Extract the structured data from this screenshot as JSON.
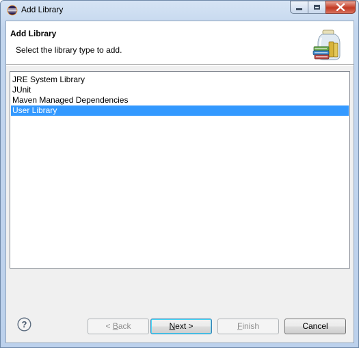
{
  "window": {
    "title": "Add Library",
    "icon": "eclipse-icon"
  },
  "header": {
    "title": "Add Library",
    "description": "Select the library type to add.",
    "image": "library-jar-books-icon"
  },
  "library_types": [
    {
      "label": "JRE System Library",
      "selected": false
    },
    {
      "label": "JUnit",
      "selected": false
    },
    {
      "label": "Maven Managed Dependencies",
      "selected": false
    },
    {
      "label": "User Library",
      "selected": true
    }
  ],
  "buttons": {
    "back": {
      "label": "< Back",
      "mnemonic": "B",
      "enabled": false
    },
    "next": {
      "label": "Next >",
      "mnemonic": "N",
      "enabled": true,
      "default": true
    },
    "finish": {
      "label": "Finish",
      "mnemonic": "F",
      "enabled": false
    },
    "cancel": {
      "label": "Cancel",
      "enabled": true
    }
  },
  "help": {
    "icon": "help-icon"
  },
  "colors": {
    "selection": "#3399ff",
    "title_bar": "#c3d6ee",
    "close_button": "#c7442e"
  }
}
